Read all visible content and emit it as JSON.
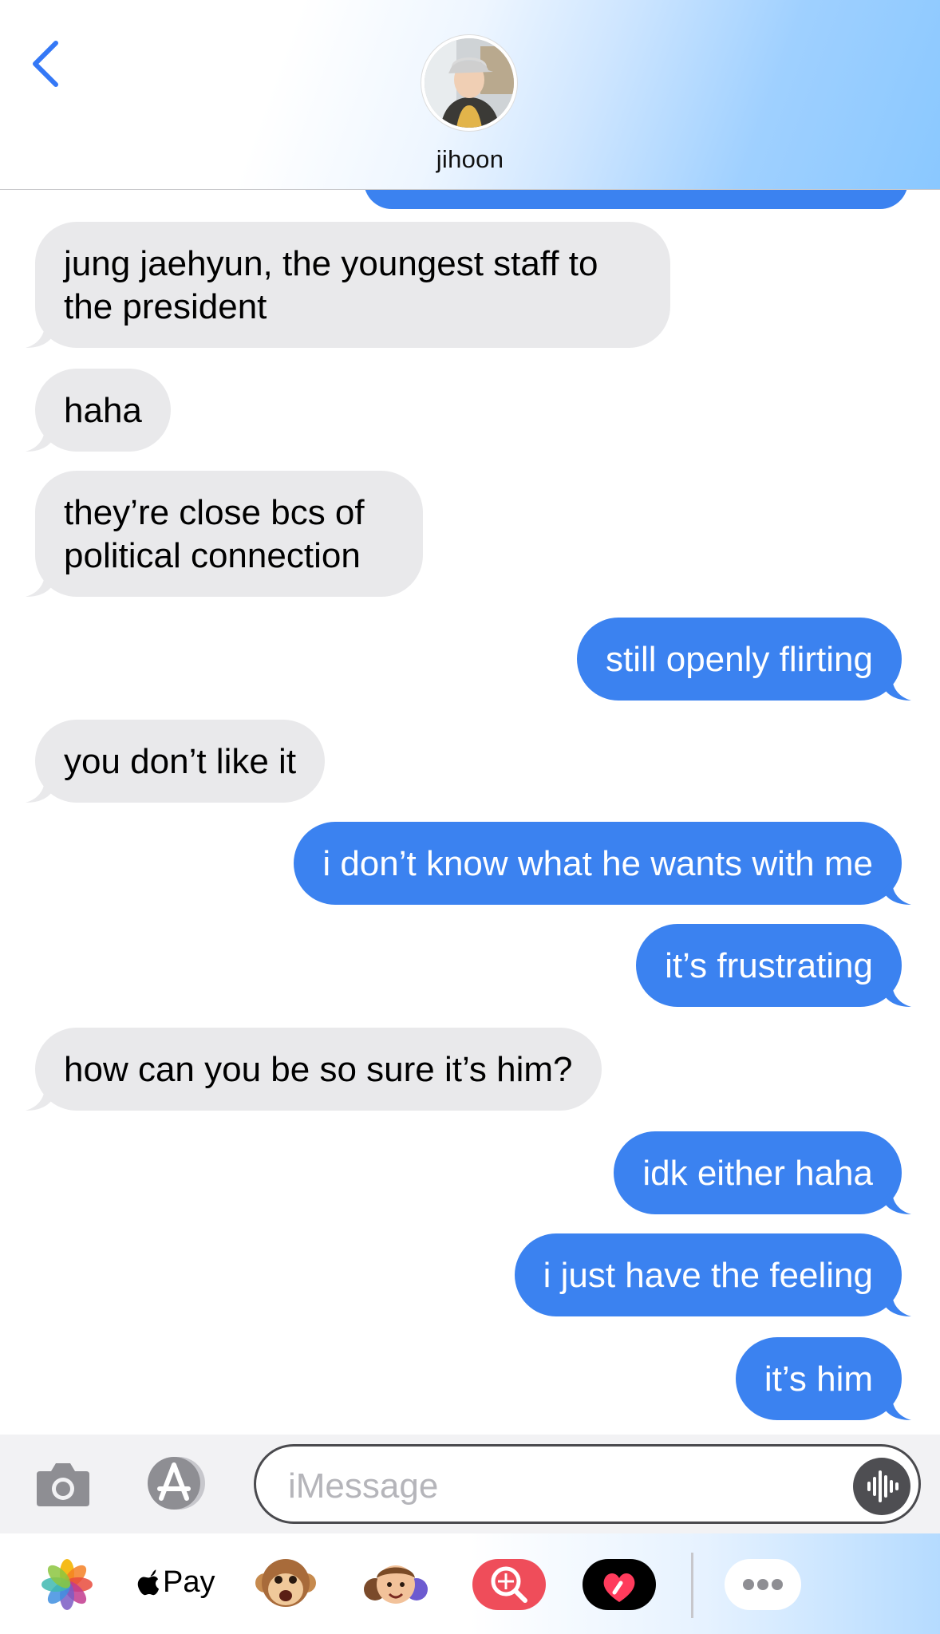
{
  "header": {
    "contact_name": "jihoon",
    "accent_color": "#3478f6"
  },
  "messages": [
    {
      "dir": "in",
      "text": "jung jaehyun, the youngest staff to the president"
    },
    {
      "dir": "in",
      "text": "haha"
    },
    {
      "dir": "in",
      "text": "they’re close bcs of political connection"
    },
    {
      "dir": "out",
      "text": "still openly flirting"
    },
    {
      "dir": "in",
      "text": "you don’t like it"
    },
    {
      "dir": "out",
      "text": "i don’t know what he wants with me"
    },
    {
      "dir": "out",
      "text": "it’s frustrating"
    },
    {
      "dir": "in",
      "text": "how can you be so sure it’s him?"
    },
    {
      "dir": "out",
      "text": "idk either haha"
    },
    {
      "dir": "out",
      "text": "i just have the feeling"
    },
    {
      "dir": "out",
      "text": "it’s him"
    }
  ],
  "composer": {
    "placeholder": "iMessage",
    "value": ""
  },
  "drawer": {
    "apple_pay_label": "Pay",
    "apps": [
      "photos-icon",
      "apple-pay-icon",
      "animoji-icon",
      "memoji-icon",
      "search-images-icon",
      "digital-touch-icon",
      "more-apps-icon"
    ]
  },
  "colors": {
    "outgoing_bubble": "#3b82f0",
    "incoming_bubble": "#e9e9eb"
  }
}
